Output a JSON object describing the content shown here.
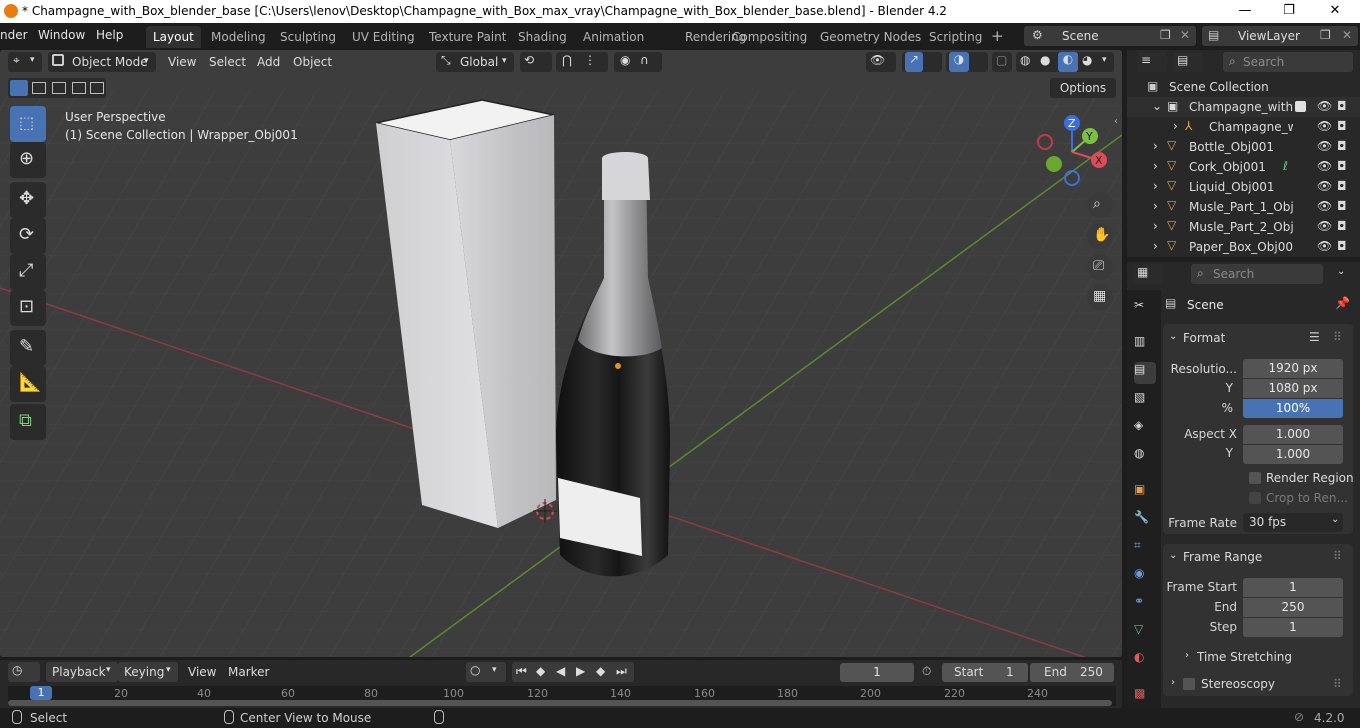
{
  "window": {
    "title": "* Champagne_with_Box_blender_base [C:\\Users\\lenov\\Desktop\\Champagne_with_Box_max_vray\\Champagne_with_Box_blender_base.blend] - Blender 4.2",
    "minimize": "—",
    "maximize": "❐",
    "close": "✕"
  },
  "menubar": {
    "render": "nder",
    "window": "Window",
    "help": "Help"
  },
  "workspaces": [
    "Layout",
    "Modeling",
    "Sculpting",
    "UV Editing",
    "Texture Paint",
    "Shading",
    "Animation",
    "Rendering",
    "Compositing",
    "Geometry Nodes",
    "Scripting"
  ],
  "topright": {
    "scene": "Scene",
    "viewlayer": "ViewLayer",
    "add_ws": "+"
  },
  "viewport_header": {
    "mode": "Object Mode",
    "menus": [
      "View",
      "Select",
      "Add",
      "Object"
    ],
    "orientation": "Global",
    "options": "Options"
  },
  "viewport": {
    "perspective": "User Perspective",
    "collection_info": "(1) Scene Collection | Wrapper_Obj001",
    "gizmo": {
      "z": "Z",
      "y": "Y",
      "x": "X"
    }
  },
  "outliner": {
    "search_placeholder": "Search",
    "root": "Scene Collection",
    "rows": [
      {
        "label": "Champagne_with_B"
      },
      {
        "label": "Champagne_wi"
      },
      {
        "label": "Bottle_Obj001"
      },
      {
        "label": "Cork_Obj001"
      },
      {
        "label": "Liquid_Obj001"
      },
      {
        "label": "Musle_Part_1_Obj0"
      },
      {
        "label": "Musle_Part_2_Obj0"
      },
      {
        "label": "Paper_Box_Obj001"
      }
    ]
  },
  "properties": {
    "search_placeholder": "Search",
    "context": "Scene",
    "format": {
      "title": "Format",
      "resolution_label": "Resolutio...",
      "res_x": "1920 px",
      "y_label": "Y",
      "res_y": "1080 px",
      "pct_label": "%",
      "pct": "100%",
      "aspect_label": "Aspect X",
      "aspect_x": "1.000",
      "aspect_y_label": "Y",
      "aspect_y": "1.000",
      "render_region": "Render Region",
      "crop": "Crop to Ren...",
      "frame_rate_label": "Frame Rate",
      "frame_rate": "30 fps"
    },
    "frame_range": {
      "title": "Frame Range",
      "start_label": "Frame Start",
      "start": "1",
      "end_label": "End",
      "end": "250",
      "step_label": "Step",
      "step": "1"
    },
    "time_stretching": "Time Stretching",
    "stereoscopy": "Stereoscopy"
  },
  "timeline": {
    "menus": [
      "Playback",
      "Keying",
      "View",
      "Marker"
    ],
    "current_frame": "1",
    "start_label": "Start",
    "start": "1",
    "end_label": "End",
    "end": "250",
    "ticks": [
      "1",
      "20",
      "40",
      "60",
      "80",
      "100",
      "120",
      "140",
      "160",
      "180",
      "200",
      "220",
      "240"
    ]
  },
  "statusbar": {
    "select": "Select",
    "center": "Center View to Mouse",
    "version": "4.2.0"
  }
}
